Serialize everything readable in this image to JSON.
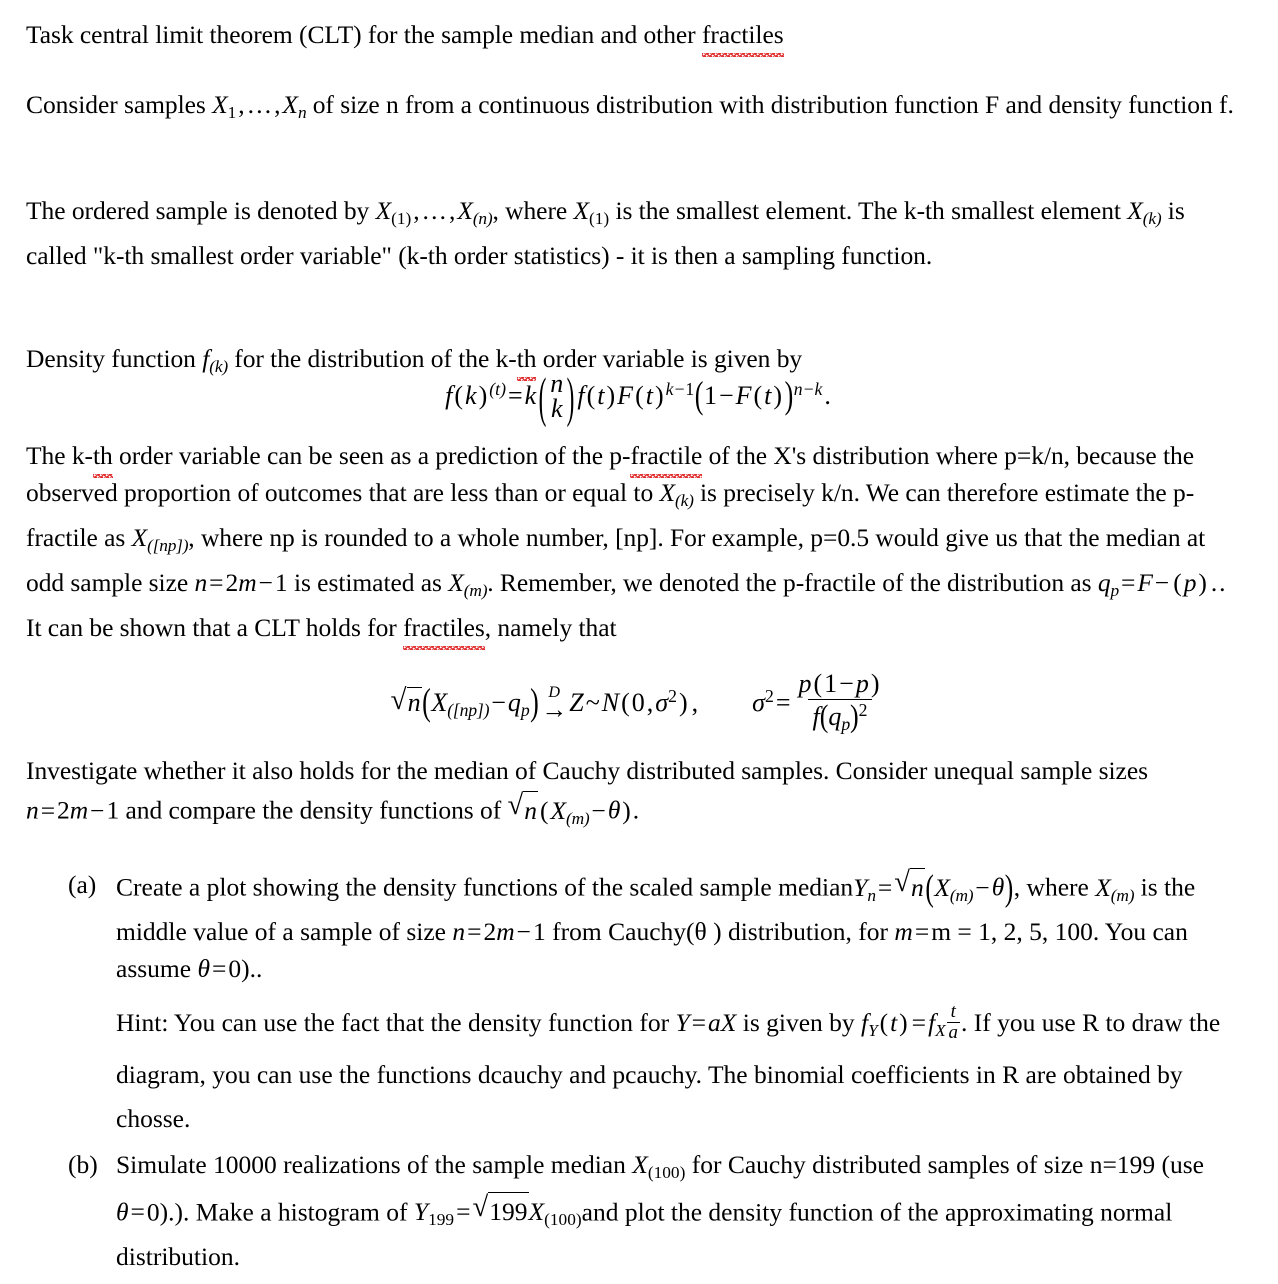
{
  "document": {
    "title_line": "Task central limit theorem (CLT) for the sample median and other fractiles",
    "title_plain": "Task central limit theorem (CLT) for the sample median and other ",
    "title_misspelled": "fractiles",
    "paragraphs": {
      "p1_a": "Consider samples ",
      "p1_b": " of size n from a continuous distribution with distribution function F and density function f.",
      "p2_a": "The ordered sample is denoted by ",
      "p2_b": ", where ",
      "p2_c": " is the smallest element. The k-th smallest element ",
      "p2_d": " is called \"k-th smallest order variable\" (k-th order statistics) - it is then a sampling function.",
      "p3_a": "Density function ",
      "p3_b": " for the distribution of the k-",
      "p3_misspelled": "th",
      "p3_c": " order variable is given by",
      "p4_a": "The k-",
      "p4_misspelled_1": "th",
      "p4_b": " order variable can be seen as a prediction of the p-",
      "p4_misspelled_2": "fractile",
      "p4_c": " of the X's distribution where p=k/n, because the observed proportion of outcomes that are less than or equal to ",
      "p4_d": " is precisely k/n. We can therefore estimate the p-fractile as ",
      "p4_e": ", where np is rounded to a whole number, [np]. For example, p=0.5 would give us that the median at odd sample size ",
      "p4_f": " is estimated as ",
      "p4_g": ". Remember, we denoted the p-fractile of the distribution as ",
      "p4_h": ". It can be shown that a CLT holds for ",
      "p4_misspelled_3": "fractiles",
      "p4_i": ", namely that",
      "p5_a": "Investigate whether it also holds for the median of Cauchy distributed samples. Consider unequal sample sizes ",
      "p5_b": " and compare the density functions of ",
      "p5_c": "."
    },
    "equations": {
      "order_density_label": "f(k)^(t) = k (n k) f(t)F(t)^(k-1)(1 - F(t))^(n-k).",
      "clt_label": "sqrt(n)(X_([np]) - q_p) ->D Z~N(0, sigma^2),  sigma^2 = p(1-p) / f(q_p)^2"
    },
    "list": [
      {
        "marker": "(a)",
        "text_a": "Create a plot showing the density functions of the scaled sample median",
        "text_b": ", where ",
        "text_c": " is the middle value of a sample of size ",
        "text_d": " from Cauchy(θ ) distribution, for ",
        "m_values": "m = 1, 2, 5, 100.",
        "text_e": "  You can assume ",
        "text_f": ")..",
        "hint_a": "Hint: You can use the fact that the density function for ",
        "hint_b": " is given by ",
        "hint_c": ". If you use R to draw the diagram, you can use the functions dcauchy and pcauchy. The binomial coefficients in R are obtained by chosse."
      },
      {
        "marker": "(b)",
        "text_a": "Simulate 10000 realizations of the sample median ",
        "text_b": " for Cauchy distributed samples of size n=199 (use ",
        "text_c": ").). Make a histogram of ",
        "text_d": "and plot the density function of the approximating normal distribution."
      }
    ],
    "symbols": {
      "X": "X",
      "Y": "Y",
      "Z": "Z",
      "n": "n",
      "m": "m",
      "k": "k",
      "f": "f",
      "F": "F",
      "t": "t",
      "a": "a",
      "p": "p",
      "q": "q",
      "theta": "θ",
      "sigma": "σ",
      "D": "D",
      "sub_1": "1",
      "sub_n": "n",
      "sub_k": "k",
      "sub_m": "m",
      "sub_p": "p",
      "sub_np": "[np]",
      "sub_100": "(100)",
      "sub_199": "199",
      "num_199": "199",
      "num_2": "2",
      "num_0": "0",
      "exp_2": "2",
      "ellipsis": "…",
      "minus": "−",
      "equals": "=",
      "tilde": "~",
      "arrow": "→"
    },
    "colors": {
      "text": "#000000",
      "spellcheck_underline": "#e03030",
      "page_background": "#ffffff"
    }
  }
}
